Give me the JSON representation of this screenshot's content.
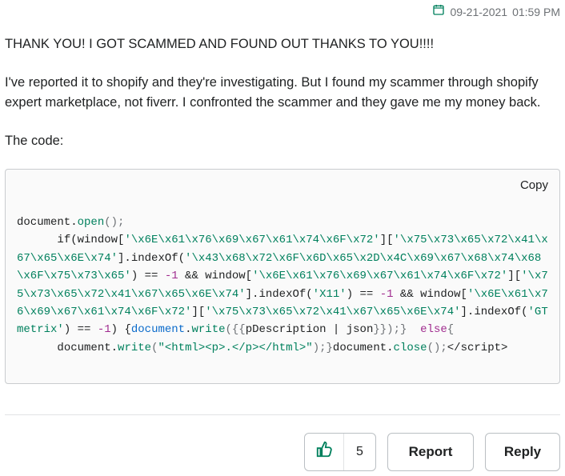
{
  "timestamp": {
    "date": "09-21-2021",
    "time": "01:59 PM"
  },
  "post": {
    "p1": "THANK YOU! I GOT SCAMMED AND FOUND OUT THANKS TO YOU!!!!",
    "p2": "I've reported it to shopify and they're investigating. But I found my scammer through shopify expert marketplace, not fiverr. I confronted the scammer and they gave me my money back.",
    "p3": "The code:"
  },
  "code": {
    "copy_label": "Copy",
    "line1": {
      "a": "document.",
      "b": "open",
      "c": "();"
    },
    "line2": {
      "a": "      if(window[",
      "b": "'\\x6E\\x61\\x76\\x69\\x67\\x61\\x74\\x6F\\x72'",
      "c": "][",
      "d": "'\\x75\\x73\\x65\\x72\\x41\\x67\\x65\\x6E\\x74'",
      "e": "].indexOf(",
      "f": "'\\x43\\x68\\x72\\x6F\\x6D\\x65\\x2D\\x4C\\x69\\x67\\x68\\x74\\x68\\x6F\\x75\\x73\\x65'",
      "g": ") == ",
      "h": "-1",
      "i": " && window[",
      "j": "'\\x6E\\x61\\x76\\x69\\x67\\x61\\x74\\x6F\\x72'",
      "k": "][",
      "l": "'\\x75\\x73\\x65\\x72\\x41\\x67\\x65\\x6E\\x74'",
      "m": "].indexOf(",
      "n": "'X11'",
      "o": ") == ",
      "p": "-1",
      "q": " && window[",
      "r": "'\\x6E\\x61\\x76\\x69\\x67\\x61\\x74\\x6F\\x72'",
      "s": "][",
      "t": "'\\x75\\x73\\x65\\x72\\x41\\x67\\x65\\x6E\\x74'",
      "u": "].indexOf(",
      "v": "'GTmetrix'",
      "w": ") == ",
      "x": "-1",
      "y": ") {",
      "z1": "document",
      "z2": ".",
      "z3": "write",
      "z4": "({{",
      "z5": "pDescription | json",
      "z6": "}});}",
      "z7": "  else",
      "z8": "{"
    },
    "line3": {
      "a": "      document.",
      "b": "write",
      "c": "(",
      "d": "\"<html><p>.</p></html>\"",
      "e": ");}",
      "f": "document.",
      "g": "close",
      "h": "();",
      "i": "</script>"
    }
  },
  "actions": {
    "like_count": "5",
    "report_label": "Report",
    "reply_label": "Reply"
  }
}
